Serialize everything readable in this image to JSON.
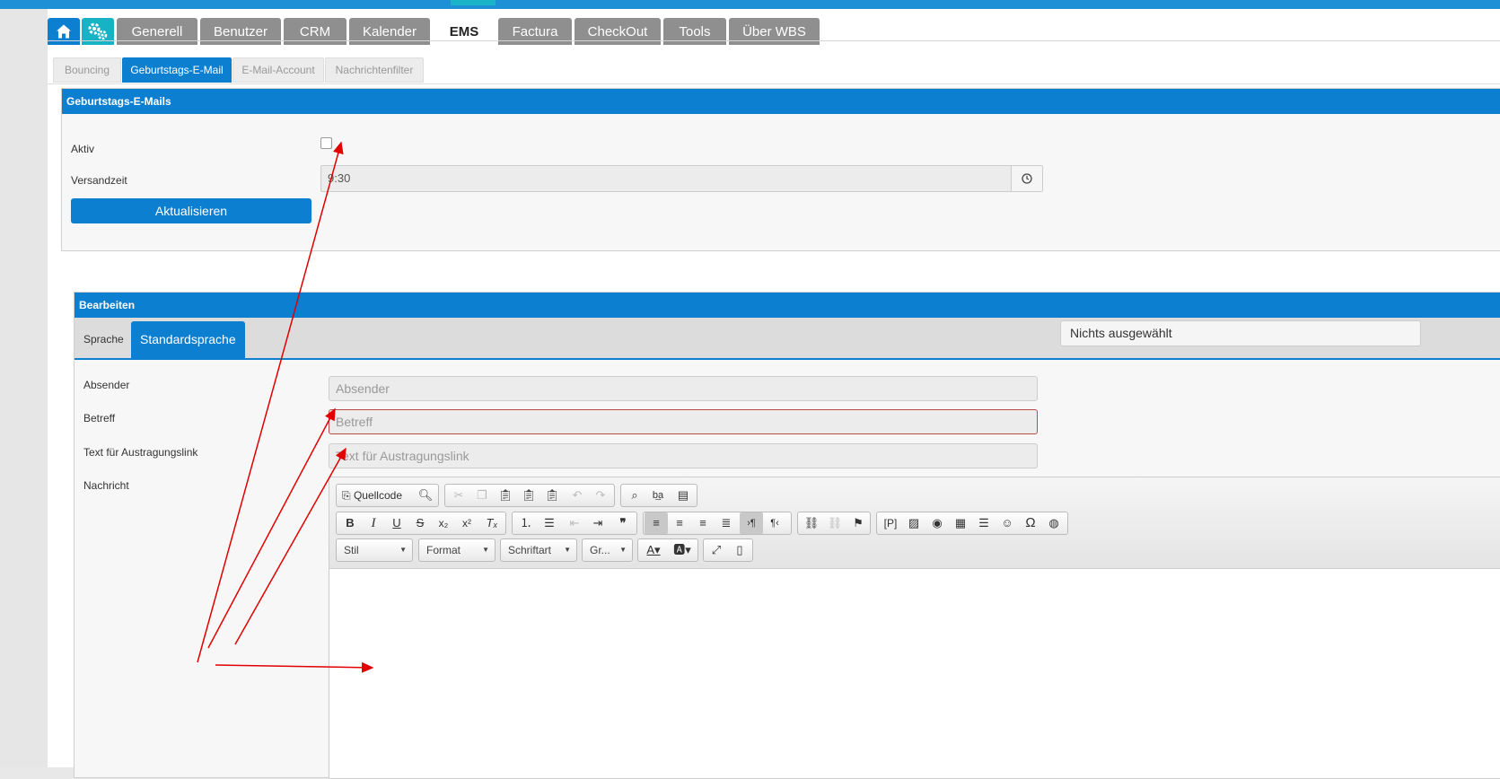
{
  "main_tabs": [
    "Generell",
    "Benutzer",
    "CRM",
    "Kalender",
    "EMS",
    "Factura",
    "CheckOut",
    "Tools",
    "Über WBS"
  ],
  "sub_tabs": [
    "Bouncing",
    "Geburtstags-E-Mail",
    "E-Mail-Account",
    "Nachrichtenfilter"
  ],
  "birthday_panel": {
    "title": "Geburtstags-E-Mails",
    "active_label": "Aktiv",
    "active_checked": false,
    "send_time_label": "Versandzeit",
    "send_time_value": "9:30",
    "update_button": "Aktualisieren"
  },
  "edit_panel": {
    "title": "Bearbeiten",
    "tab_language": "Sprache",
    "tab_default": "Standardsprache",
    "language_select": "Nichts ausgewählt",
    "sender_label": "Absender",
    "sender_placeholder": "Absender",
    "subject_label": "Betreff",
    "subject_placeholder": "Betreff",
    "unsubscribe_label": "Text für Austragungslink",
    "unsubscribe_placeholder": "Text für Austragungslink",
    "message_label": "Nachricht"
  },
  "editor": {
    "source_button": "Quellcode",
    "style_combo": "Stil",
    "format_combo": "Format",
    "font_combo": "Schriftart",
    "size_combo": "Gr..."
  },
  "colors": {
    "accent": "#0d7fd1",
    "tab_gray": "#8f8f8f",
    "annotation": "#e00000"
  }
}
